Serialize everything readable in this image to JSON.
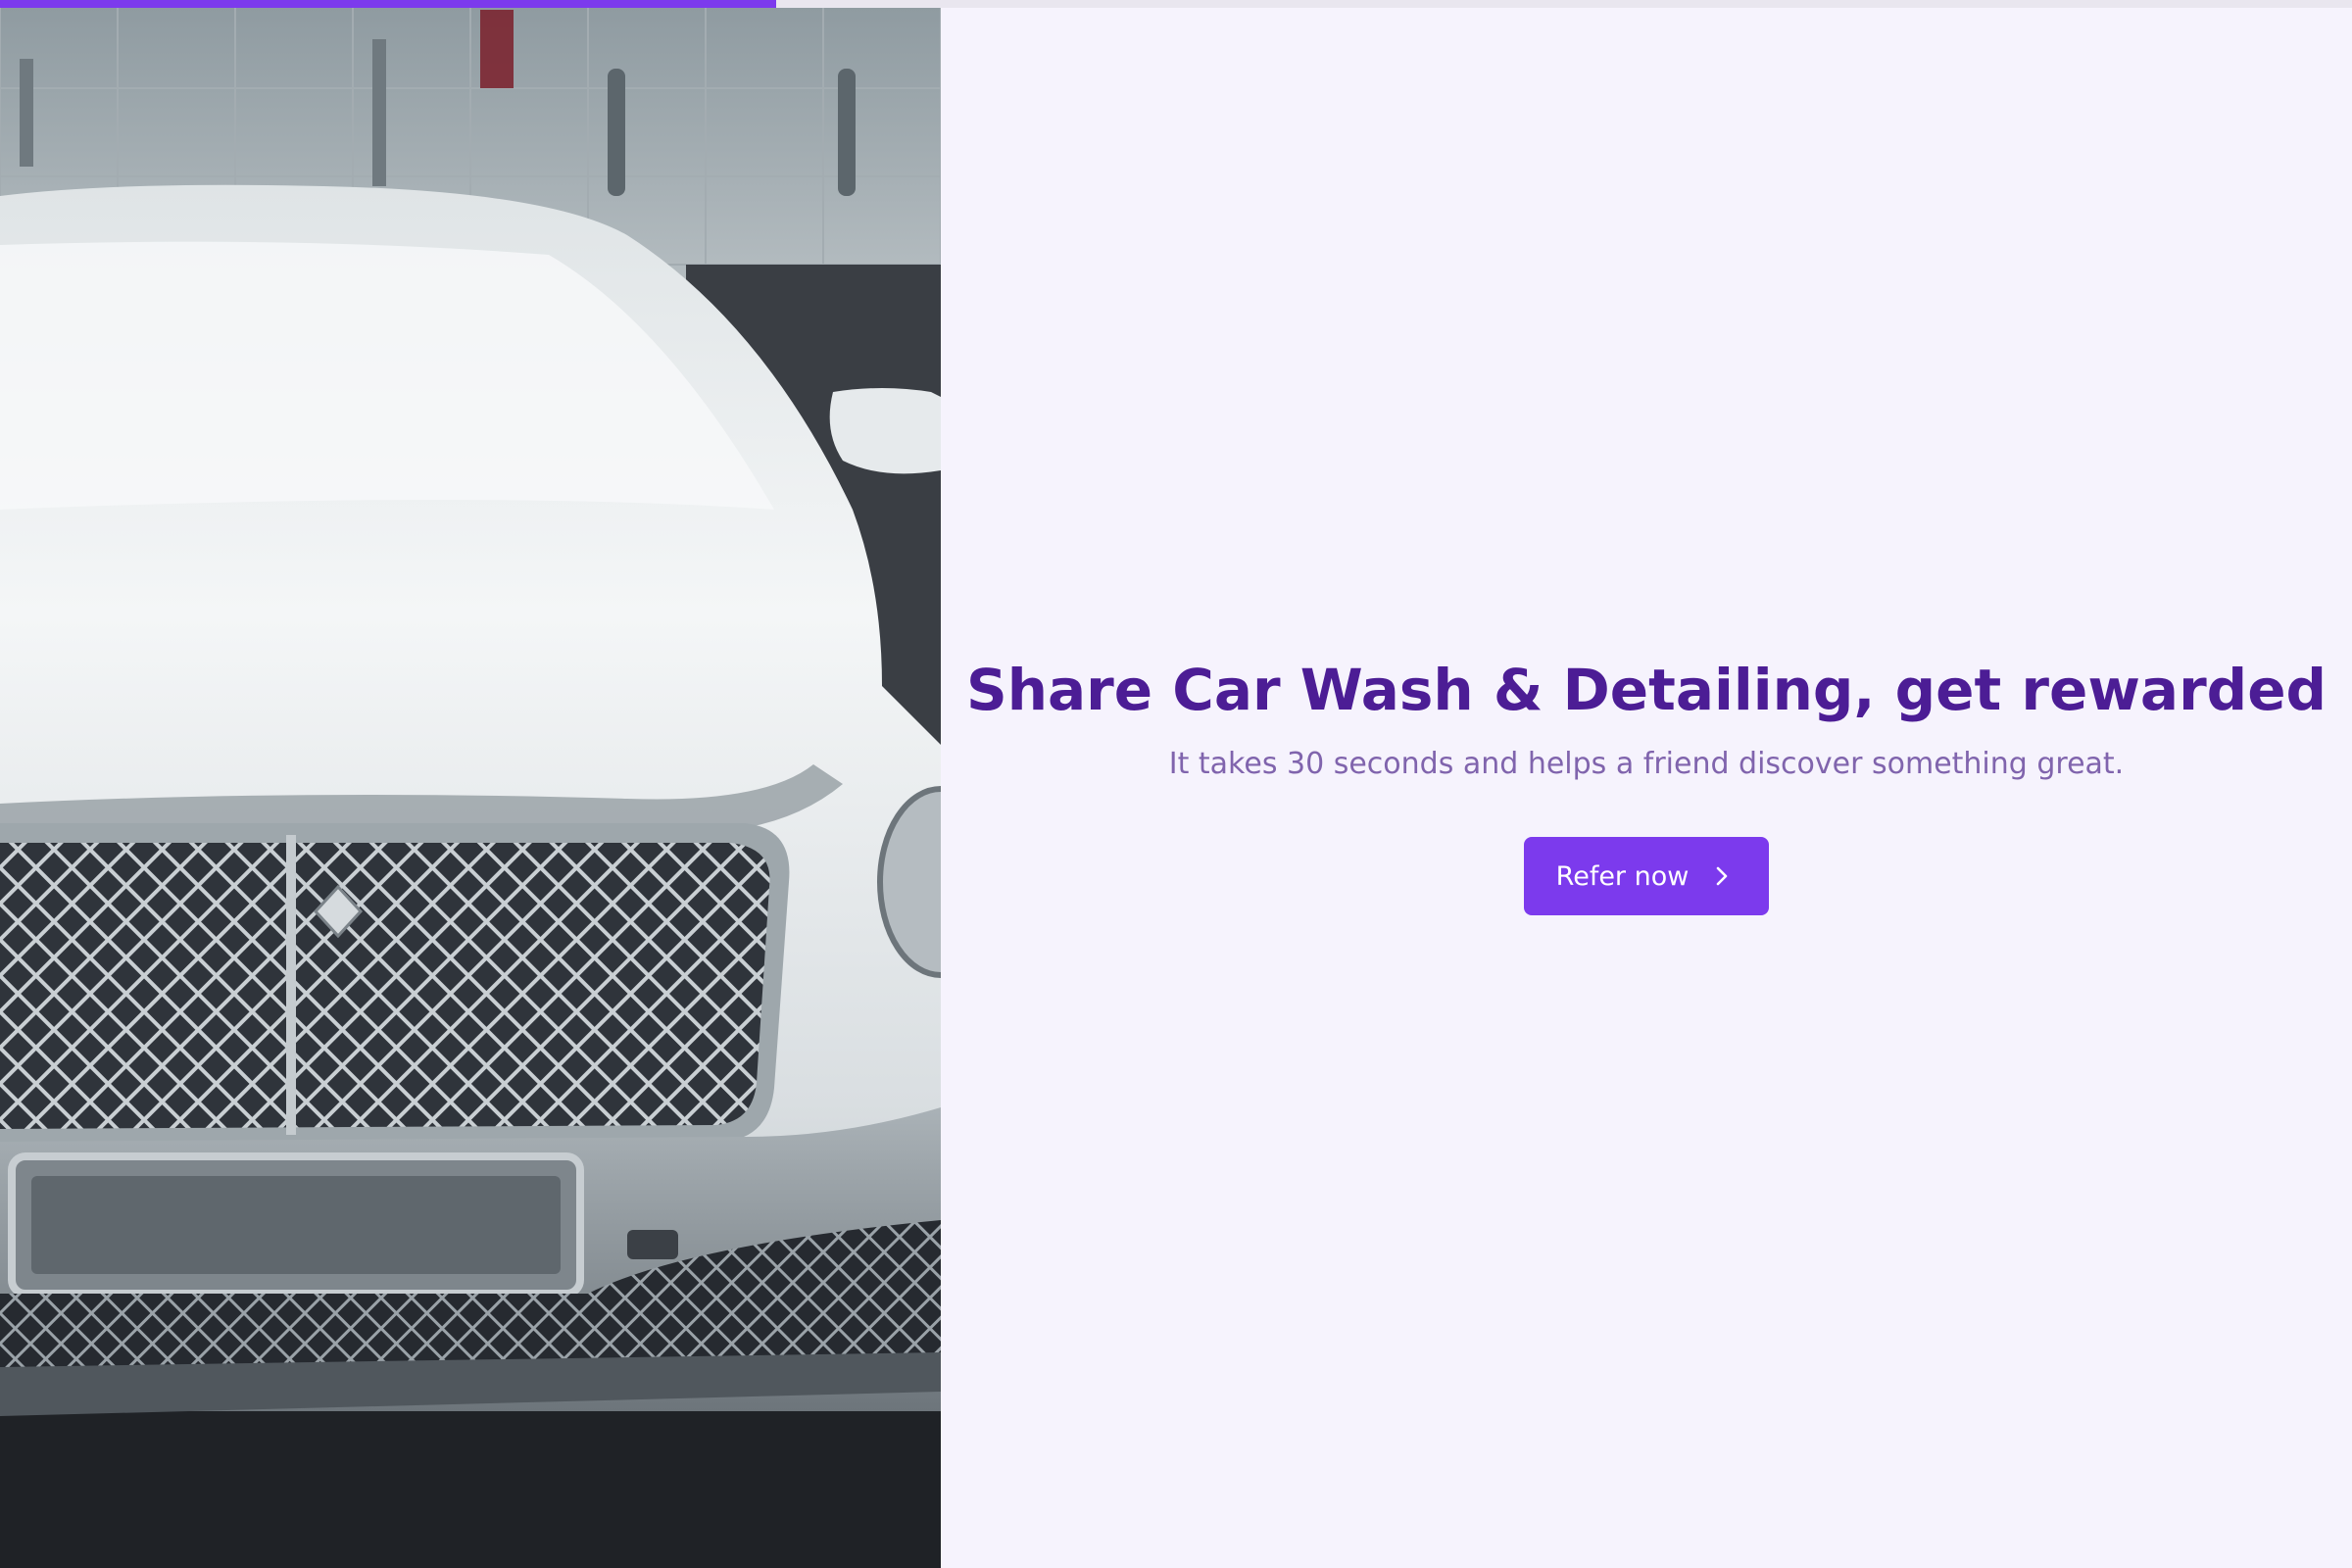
{
  "progress": {
    "fraction": 0.33,
    "color": "#7c3aed"
  },
  "hero": {
    "icon": "car-photo",
    "alt": "Foam-covered car being washed"
  },
  "content": {
    "headline": "Share Car Wash & Detailing, get rewarded",
    "subtext": "It takes 30 seconds and helps a friend discover something great.",
    "cta_label": "Refer now",
    "cta_icon": "chevron-right-icon"
  },
  "colors": {
    "accent": "#7c3aed",
    "headline": "#4c1d95",
    "subtext": "#8064ad",
    "background": "#f6f3fd"
  }
}
